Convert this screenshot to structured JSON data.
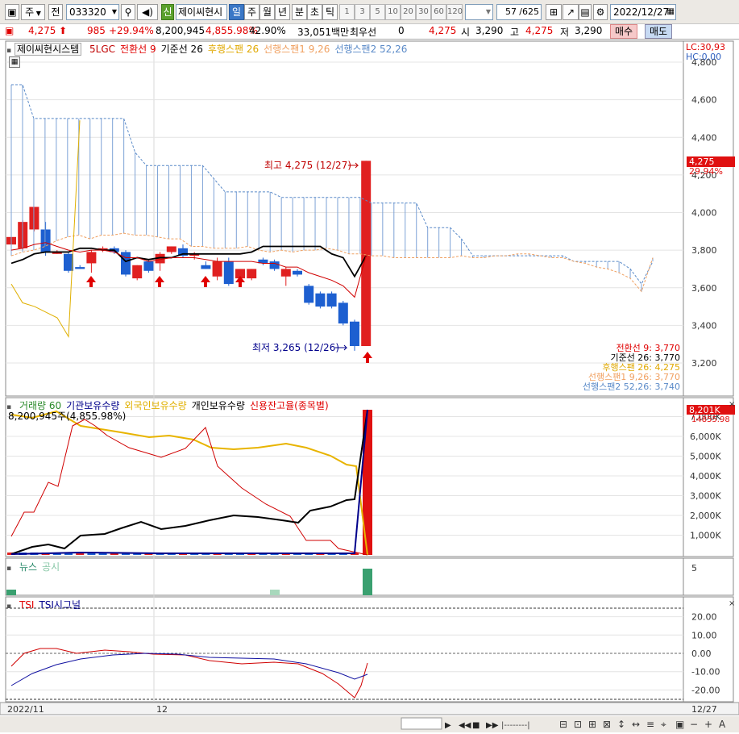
{
  "toolbar": {
    "market_label": "주",
    "all_label": "전",
    "code": "033320",
    "stock_badge": "신",
    "stock_name": "제이씨현시",
    "periods": [
      "일",
      "주",
      "월",
      "년",
      "분",
      "초",
      "틱"
    ],
    "active_period": "일",
    "intervals": [
      "1",
      "3",
      "5",
      "10",
      "20",
      "30",
      "60",
      "120"
    ],
    "count": "57",
    "total": "/625",
    "date": "2022/12/27"
  },
  "quote": {
    "price": "4,275",
    "change": "985",
    "change_pct": "+29.94%",
    "volume": "8,200,945",
    "volume_pct": "4,855.98%",
    "ratio": "42.90%",
    "amount": "33,051백만",
    "pref_label": "최우선",
    "pref_value": "0",
    "quote_price": "4,275",
    "open_label": "시",
    "open": "3,290",
    "high_label": "고",
    "high": "4,275",
    "low_label": "저",
    "low": "3,290",
    "buy_label": "매수",
    "sell_label": "매도"
  },
  "price_pane": {
    "legend_name": "제이씨현시스템",
    "legend_items": [
      {
        "text": "5LGC",
        "color": "#c00000"
      },
      {
        "text": "전환선 9",
        "color": "#e00000"
      },
      {
        "text": "기준선 26",
        "color": "#000000"
      },
      {
        "text": "후행스팬 26",
        "color": "#e0a800"
      },
      {
        "text": "선행스팬1 9,26",
        "color": "#f0a060"
      },
      {
        "text": "선행스팬2 52,26",
        "color": "#5a8ac8"
      }
    ],
    "lc": "LC:30,93",
    "hc": "HC:0,00",
    "y_ticks": [
      "4,800",
      "4,600",
      "4,400",
      "4,200",
      "4,000",
      "3,800",
      "3,600",
      "3,400",
      "3,200"
    ],
    "last_price": "4,275",
    "last_pct": "29.94%",
    "high_note": "최고 4,275 (12/27)",
    "low_note": "최저 3,265 (12/26)",
    "values": [
      {
        "text": "전환선 9: 3,770",
        "color": "#e00000"
      },
      {
        "text": "기준선 26: 3,770",
        "color": "#000000"
      },
      {
        "text": "후행스팬 26: 4,275",
        "color": "#e0a800"
      },
      {
        "text": "선행스팬1 9,26: 3,770",
        "color": "#f0a060"
      },
      {
        "text": "선행스팬2 52,26: 3,740",
        "color": "#5a8ac8"
      }
    ]
  },
  "volume_pane": {
    "legend_items": [
      {
        "text": "거래량  60",
        "color": "#2a8a2a"
      },
      {
        "text": "기관보유수량",
        "color": "#00008b"
      },
      {
        "text": "외국인보유수량",
        "color": "#e0b000"
      },
      {
        "text": "개인보유수량",
        "color": "#000000"
      },
      {
        "text": "신용잔고율(종목별)",
        "color": "#e00000"
      }
    ],
    "note": "8,200,945주(4,855.98%)",
    "y_ticks": [
      "7,000K",
      "6,000K",
      "5,000K",
      "4,000K",
      "3,000K",
      "2,000K",
      "1,000K"
    ],
    "last_vol": "8,201K",
    "last_pct": "14855.98"
  },
  "news_pane": {
    "legend_items": [
      {
        "text": "뉴스",
        "color": "#2a8a6a"
      },
      {
        "text": "공시",
        "color": "#8ac8a8"
      }
    ],
    "y_tick": "5"
  },
  "tsi_pane": {
    "legend_items": [
      {
        "text": "TSI",
        "color": "#e00000"
      },
      {
        "text": "TSI시그널",
        "color": "#00008b"
      }
    ],
    "y_ticks": [
      "20.00",
      "10.00",
      "0.00",
      "-10.00",
      "-20.00"
    ]
  },
  "xaxis": {
    "labels": [
      "2022/11",
      "12"
    ],
    "right_label": "12/27"
  },
  "chart_data": {
    "type": "candlestick",
    "title": "제이씨현시스템",
    "dates_shown": [
      "2022/11",
      "12",
      "12/27"
    ],
    "candles": [
      {
        "o": 3830,
        "h": 3860,
        "l": 3800,
        "c": 3870,
        "dir": "up"
      },
      {
        "o": 3810,
        "h": 3960,
        "l": 3800,
        "c": 3950,
        "dir": "up"
      },
      {
        "o": 3910,
        "h": 4030,
        "l": 3900,
        "c": 4030,
        "dir": "up"
      },
      {
        "o": 3910,
        "h": 3950,
        "l": 3770,
        "c": 3790,
        "dir": "down"
      },
      {
        "o": 3790,
        "h": 3800,
        "l": 3780,
        "c": 3780,
        "dir": "up"
      },
      {
        "o": 3780,
        "h": 3790,
        "l": 3680,
        "c": 3690,
        "dir": "down"
      },
      {
        "o": 3710,
        "h": 3720,
        "l": 3700,
        "c": 3700,
        "dir": "down"
      },
      {
        "o": 3730,
        "h": 3800,
        "l": 3680,
        "c": 3790,
        "dir": "up"
      },
      {
        "o": 3800,
        "h": 3820,
        "l": 3790,
        "c": 3810,
        "dir": "up"
      },
      {
        "o": 3810,
        "h": 3820,
        "l": 3780,
        "c": 3790,
        "dir": "down"
      },
      {
        "o": 3790,
        "h": 3800,
        "l": 3660,
        "c": 3670,
        "dir": "down"
      },
      {
        "o": 3650,
        "h": 3720,
        "l": 3640,
        "c": 3720,
        "dir": "up"
      },
      {
        "o": 3740,
        "h": 3750,
        "l": 3680,
        "c": 3690,
        "dir": "down"
      },
      {
        "o": 3730,
        "h": 3790,
        "l": 3690,
        "c": 3780,
        "dir": "up"
      },
      {
        "o": 3790,
        "h": 3820,
        "l": 3780,
        "c": 3820,
        "dir": "up"
      },
      {
        "o": 3810,
        "h": 3830,
        "l": 3760,
        "c": 3770,
        "dir": "down"
      },
      {
        "o": 3770,
        "h": 3790,
        "l": 3750,
        "c": 3780,
        "dir": "up"
      },
      {
        "o": 3720,
        "h": 3740,
        "l": 3700,
        "c": 3700,
        "dir": "down"
      },
      {
        "o": 3660,
        "h": 3760,
        "l": 3640,
        "c": 3740,
        "dir": "up"
      },
      {
        "o": 3740,
        "h": 3760,
        "l": 3610,
        "c": 3620,
        "dir": "down"
      },
      {
        "o": 3650,
        "h": 3700,
        "l": 3610,
        "c": 3700,
        "dir": "up"
      },
      {
        "o": 3650,
        "h": 3700,
        "l": 3640,
        "c": 3700,
        "dir": "up"
      },
      {
        "o": 3750,
        "h": 3760,
        "l": 3720,
        "c": 3730,
        "dir": "down"
      },
      {
        "o": 3740,
        "h": 3750,
        "l": 3690,
        "c": 3700,
        "dir": "down"
      },
      {
        "o": 3660,
        "h": 3710,
        "l": 3610,
        "c": 3700,
        "dir": "up"
      },
      {
        "o": 3690,
        "h": 3700,
        "l": 3660,
        "c": 3670,
        "dir": "down"
      },
      {
        "o": 3610,
        "h": 3620,
        "l": 3510,
        "c": 3520,
        "dir": "down"
      },
      {
        "o": 3570,
        "h": 3580,
        "l": 3490,
        "c": 3500,
        "dir": "down"
      },
      {
        "o": 3570,
        "h": 3580,
        "l": 3490,
        "c": 3500,
        "dir": "down"
      },
      {
        "o": 3520,
        "h": 3530,
        "l": 3400,
        "c": 3410,
        "dir": "down"
      },
      {
        "o": 3420,
        "h": 3430,
        "l": 3265,
        "c": 3290,
        "dir": "down"
      },
      {
        "o": 3290,
        "h": 4275,
        "l": 3290,
        "c": 4275,
        "dir": "up"
      }
    ]
  }
}
